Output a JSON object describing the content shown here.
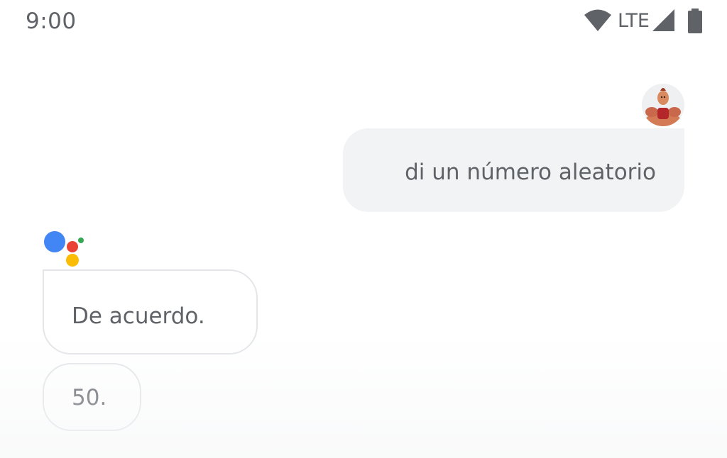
{
  "status_bar": {
    "time": "9:00",
    "network": "LTE",
    "icons": [
      "wifi-icon",
      "cell-signal-icon",
      "battery-icon"
    ]
  },
  "conversation": {
    "user_message": {
      "text": "di un número aleatorio",
      "avatar_icon": "user-avatar"
    },
    "assistant_messages": [
      {
        "text": "De acuerdo."
      },
      {
        "text": "50."
      }
    ],
    "assistant_logo_colors": {
      "blue": "#4285f4",
      "red": "#ea4335",
      "yellow": "#fbbc04",
      "green": "#34a853"
    }
  },
  "colors": {
    "user_bubble": "#f1f3f4",
    "assistant_bubble_border": "#e3e5e8",
    "text": "#5f6368"
  }
}
